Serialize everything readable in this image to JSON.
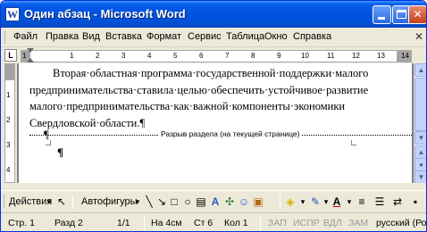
{
  "window": {
    "title": "Один абзац - Microsoft Word"
  },
  "menu": {
    "items": [
      "Файл",
      "Правка",
      "Вид",
      "Вставка",
      "Формат",
      "Сервис",
      "Таблица",
      "Окно",
      "Справка"
    ]
  },
  "ruler": {
    "tab_stop_glyph": "L",
    "numbers": [
      "1",
      "1",
      "2",
      "3",
      "4",
      "5",
      "6",
      "7",
      "8",
      "9",
      "10",
      "11",
      "12",
      "13",
      "14"
    ]
  },
  "vruler": {
    "numbers": [
      "1",
      "2",
      "3",
      "4"
    ]
  },
  "document": {
    "lines": [
      "Вторая·областная·программа·государственной·поддержки·малого",
      "предпринимательства·ставила·целью·обеспечить·устойчивое·развитие",
      "малого·предпринимательства·как·важной·компоненты·экономики",
      "Свердловской·области.¶"
    ],
    "section_break_label": "Разрыв раздела (на текущей странице)",
    "pilcrow": "¶",
    "cursor_pilcrow": "¶"
  },
  "drawing_toolbar": {
    "actions_label": "Действия",
    "autoshapes_label": "Автофигуры"
  },
  "status": {
    "page": "Стр. 1",
    "section": "Разд 2",
    "pages": "1/1",
    "at": "На 4см",
    "line": "Ст 6",
    "column": "Кол 1",
    "rec": "ЗАП",
    "trk": "ИСПР",
    "ext": "ВДЛ",
    "ovr": "ЗАМ",
    "language": "русский (Ро"
  }
}
